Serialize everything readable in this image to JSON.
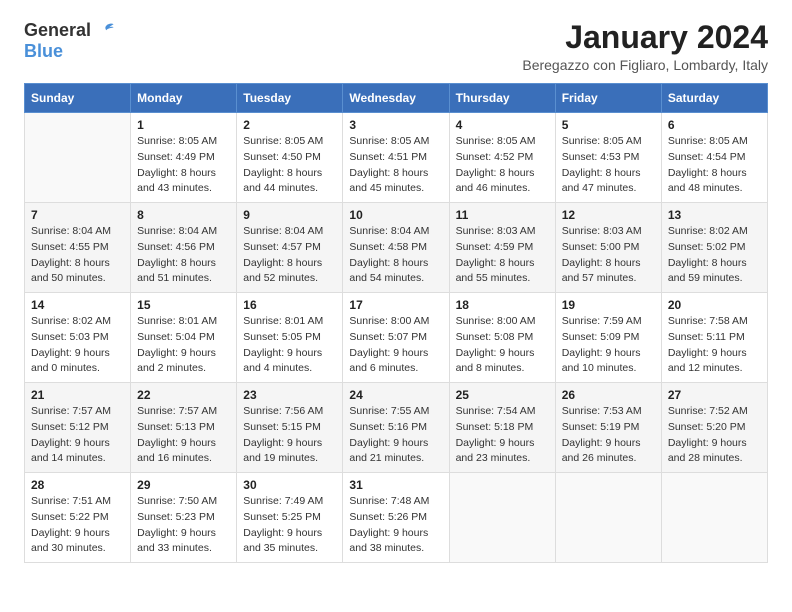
{
  "header": {
    "logo_general": "General",
    "logo_blue": "Blue",
    "month": "January 2024",
    "location": "Beregazzo con Figliaro, Lombardy, Italy"
  },
  "weekdays": [
    "Sunday",
    "Monday",
    "Tuesday",
    "Wednesday",
    "Thursday",
    "Friday",
    "Saturday"
  ],
  "weeks": [
    [
      {
        "day": "",
        "sunrise": "",
        "sunset": "",
        "daylight": ""
      },
      {
        "day": "1",
        "sunrise": "Sunrise: 8:05 AM",
        "sunset": "Sunset: 4:49 PM",
        "daylight": "Daylight: 8 hours and 43 minutes."
      },
      {
        "day": "2",
        "sunrise": "Sunrise: 8:05 AM",
        "sunset": "Sunset: 4:50 PM",
        "daylight": "Daylight: 8 hours and 44 minutes."
      },
      {
        "day": "3",
        "sunrise": "Sunrise: 8:05 AM",
        "sunset": "Sunset: 4:51 PM",
        "daylight": "Daylight: 8 hours and 45 minutes."
      },
      {
        "day": "4",
        "sunrise": "Sunrise: 8:05 AM",
        "sunset": "Sunset: 4:52 PM",
        "daylight": "Daylight: 8 hours and 46 minutes."
      },
      {
        "day": "5",
        "sunrise": "Sunrise: 8:05 AM",
        "sunset": "Sunset: 4:53 PM",
        "daylight": "Daylight: 8 hours and 47 minutes."
      },
      {
        "day": "6",
        "sunrise": "Sunrise: 8:05 AM",
        "sunset": "Sunset: 4:54 PM",
        "daylight": "Daylight: 8 hours and 48 minutes."
      }
    ],
    [
      {
        "day": "7",
        "sunrise": "Sunrise: 8:04 AM",
        "sunset": "Sunset: 4:55 PM",
        "daylight": "Daylight: 8 hours and 50 minutes."
      },
      {
        "day": "8",
        "sunrise": "Sunrise: 8:04 AM",
        "sunset": "Sunset: 4:56 PM",
        "daylight": "Daylight: 8 hours and 51 minutes."
      },
      {
        "day": "9",
        "sunrise": "Sunrise: 8:04 AM",
        "sunset": "Sunset: 4:57 PM",
        "daylight": "Daylight: 8 hours and 52 minutes."
      },
      {
        "day": "10",
        "sunrise": "Sunrise: 8:04 AM",
        "sunset": "Sunset: 4:58 PM",
        "daylight": "Daylight: 8 hours and 54 minutes."
      },
      {
        "day": "11",
        "sunrise": "Sunrise: 8:03 AM",
        "sunset": "Sunset: 4:59 PM",
        "daylight": "Daylight: 8 hours and 55 minutes."
      },
      {
        "day": "12",
        "sunrise": "Sunrise: 8:03 AM",
        "sunset": "Sunset: 5:00 PM",
        "daylight": "Daylight: 8 hours and 57 minutes."
      },
      {
        "day": "13",
        "sunrise": "Sunrise: 8:02 AM",
        "sunset": "Sunset: 5:02 PM",
        "daylight": "Daylight: 8 hours and 59 minutes."
      }
    ],
    [
      {
        "day": "14",
        "sunrise": "Sunrise: 8:02 AM",
        "sunset": "Sunset: 5:03 PM",
        "daylight": "Daylight: 9 hours and 0 minutes."
      },
      {
        "day": "15",
        "sunrise": "Sunrise: 8:01 AM",
        "sunset": "Sunset: 5:04 PM",
        "daylight": "Daylight: 9 hours and 2 minutes."
      },
      {
        "day": "16",
        "sunrise": "Sunrise: 8:01 AM",
        "sunset": "Sunset: 5:05 PM",
        "daylight": "Daylight: 9 hours and 4 minutes."
      },
      {
        "day": "17",
        "sunrise": "Sunrise: 8:00 AM",
        "sunset": "Sunset: 5:07 PM",
        "daylight": "Daylight: 9 hours and 6 minutes."
      },
      {
        "day": "18",
        "sunrise": "Sunrise: 8:00 AM",
        "sunset": "Sunset: 5:08 PM",
        "daylight": "Daylight: 9 hours and 8 minutes."
      },
      {
        "day": "19",
        "sunrise": "Sunrise: 7:59 AM",
        "sunset": "Sunset: 5:09 PM",
        "daylight": "Daylight: 9 hours and 10 minutes."
      },
      {
        "day": "20",
        "sunrise": "Sunrise: 7:58 AM",
        "sunset": "Sunset: 5:11 PM",
        "daylight": "Daylight: 9 hours and 12 minutes."
      }
    ],
    [
      {
        "day": "21",
        "sunrise": "Sunrise: 7:57 AM",
        "sunset": "Sunset: 5:12 PM",
        "daylight": "Daylight: 9 hours and 14 minutes."
      },
      {
        "day": "22",
        "sunrise": "Sunrise: 7:57 AM",
        "sunset": "Sunset: 5:13 PM",
        "daylight": "Daylight: 9 hours and 16 minutes."
      },
      {
        "day": "23",
        "sunrise": "Sunrise: 7:56 AM",
        "sunset": "Sunset: 5:15 PM",
        "daylight": "Daylight: 9 hours and 19 minutes."
      },
      {
        "day": "24",
        "sunrise": "Sunrise: 7:55 AM",
        "sunset": "Sunset: 5:16 PM",
        "daylight": "Daylight: 9 hours and 21 minutes."
      },
      {
        "day": "25",
        "sunrise": "Sunrise: 7:54 AM",
        "sunset": "Sunset: 5:18 PM",
        "daylight": "Daylight: 9 hours and 23 minutes."
      },
      {
        "day": "26",
        "sunrise": "Sunrise: 7:53 AM",
        "sunset": "Sunset: 5:19 PM",
        "daylight": "Daylight: 9 hours and 26 minutes."
      },
      {
        "day": "27",
        "sunrise": "Sunrise: 7:52 AM",
        "sunset": "Sunset: 5:20 PM",
        "daylight": "Daylight: 9 hours and 28 minutes."
      }
    ],
    [
      {
        "day": "28",
        "sunrise": "Sunrise: 7:51 AM",
        "sunset": "Sunset: 5:22 PM",
        "daylight": "Daylight: 9 hours and 30 minutes."
      },
      {
        "day": "29",
        "sunrise": "Sunrise: 7:50 AM",
        "sunset": "Sunset: 5:23 PM",
        "daylight": "Daylight: 9 hours and 33 minutes."
      },
      {
        "day": "30",
        "sunrise": "Sunrise: 7:49 AM",
        "sunset": "Sunset: 5:25 PM",
        "daylight": "Daylight: 9 hours and 35 minutes."
      },
      {
        "day": "31",
        "sunrise": "Sunrise: 7:48 AM",
        "sunset": "Sunset: 5:26 PM",
        "daylight": "Daylight: 9 hours and 38 minutes."
      },
      {
        "day": "",
        "sunrise": "",
        "sunset": "",
        "daylight": ""
      },
      {
        "day": "",
        "sunrise": "",
        "sunset": "",
        "daylight": ""
      },
      {
        "day": "",
        "sunrise": "",
        "sunset": "",
        "daylight": ""
      }
    ]
  ]
}
